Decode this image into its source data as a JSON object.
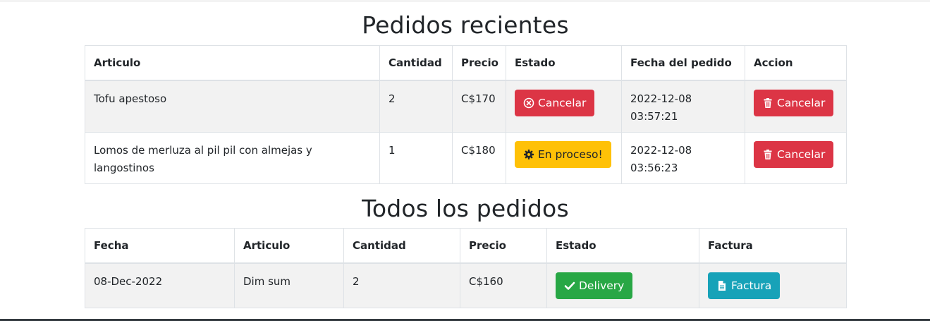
{
  "recent": {
    "title": "Pedidos recientes",
    "headers": [
      "Articulo",
      "Cantidad",
      "Precio",
      "Estado",
      "Fecha del pedido",
      "Accion"
    ],
    "rows": [
      {
        "articulo": "Tofu apestoso",
        "cantidad": "2",
        "precio": "C$170",
        "estado_label": "Cancelar",
        "estado_icon": "times-circle-icon",
        "fecha": "2022-12-08 03:57:21",
        "accion_label": "Cancelar",
        "accion_icon": "trash-icon"
      },
      {
        "articulo": "Lomos de merluza al pil pil con almejas y langostinos",
        "cantidad": "1",
        "precio": "C$180",
        "estado_label": "En proceso!",
        "estado_icon": "gear-icon",
        "fecha": "2022-12-08 03:56:23",
        "accion_label": "Cancelar",
        "accion_icon": "trash-icon"
      }
    ]
  },
  "all": {
    "title": "Todos los pedidos",
    "headers": [
      "Fecha",
      "Articulo",
      "Cantidad",
      "Precio",
      "Estado",
      "Factura"
    ],
    "rows": [
      {
        "fecha": "08-Dec-2022",
        "articulo": "Dim sum",
        "cantidad": "2",
        "precio": "C$160",
        "estado_label": "Delivery",
        "estado_icon": "check-icon",
        "factura_label": "Factura",
        "factura_icon": "file-icon"
      }
    ]
  },
  "colors": {
    "danger": "#dc3545",
    "warning": "#ffc107",
    "success": "#28a745",
    "info": "#17a2b8"
  }
}
